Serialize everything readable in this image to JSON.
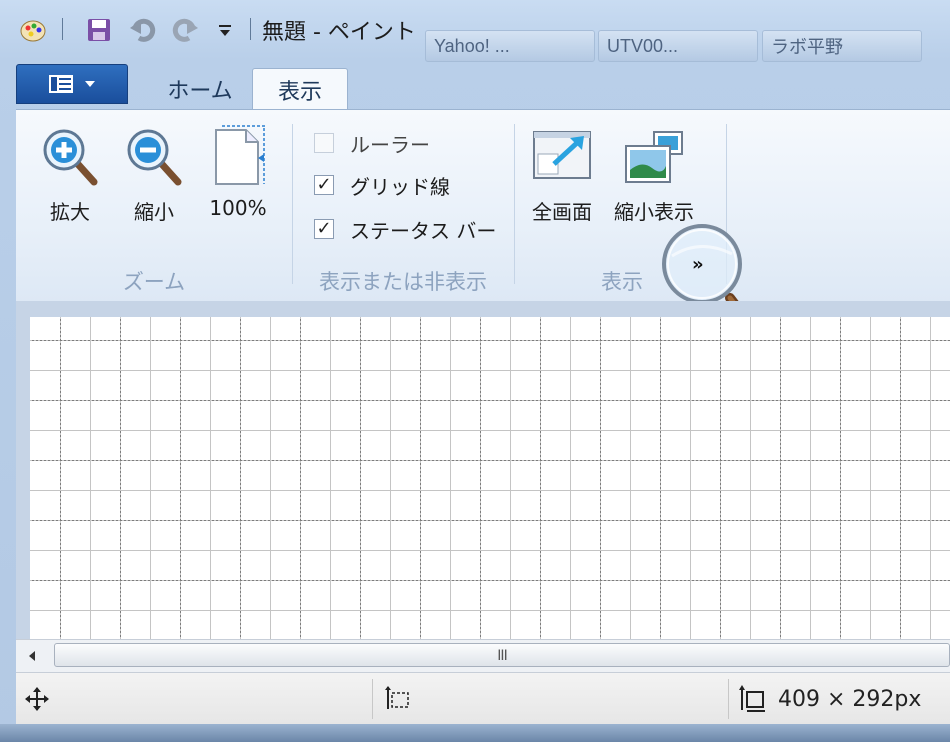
{
  "window": {
    "title": "無題 - ペイント"
  },
  "background_tabs": [
    "Yahoo! ...",
    "UTV00...",
    "ラボ平野"
  ],
  "qat": {
    "icons": [
      "paint-app-icon",
      "save-icon",
      "undo-icon",
      "redo-icon",
      "customize-dropdown-icon"
    ]
  },
  "ribbon": {
    "tabs": [
      {
        "label": "ホーム",
        "active": false
      },
      {
        "label": "表示",
        "active": true
      }
    ],
    "groups": {
      "zoom": {
        "label": "ズーム",
        "buttons": [
          "拡大",
          "縮小",
          "100%"
        ]
      },
      "show_hide": {
        "label": "表示または非表示",
        "options": [
          {
            "label": "ルーラー",
            "checked": false
          },
          {
            "label": "グリッド線",
            "checked": true
          },
          {
            "label": "ステータス バー",
            "checked": true
          }
        ]
      },
      "display": {
        "label": "表示",
        "buttons": [
          "全画面",
          "縮小表示"
        ]
      }
    },
    "overflow_label": "»"
  },
  "scrollbar": {
    "grip": "III"
  },
  "statusbar": {
    "canvas_size": "409 × 292px"
  }
}
